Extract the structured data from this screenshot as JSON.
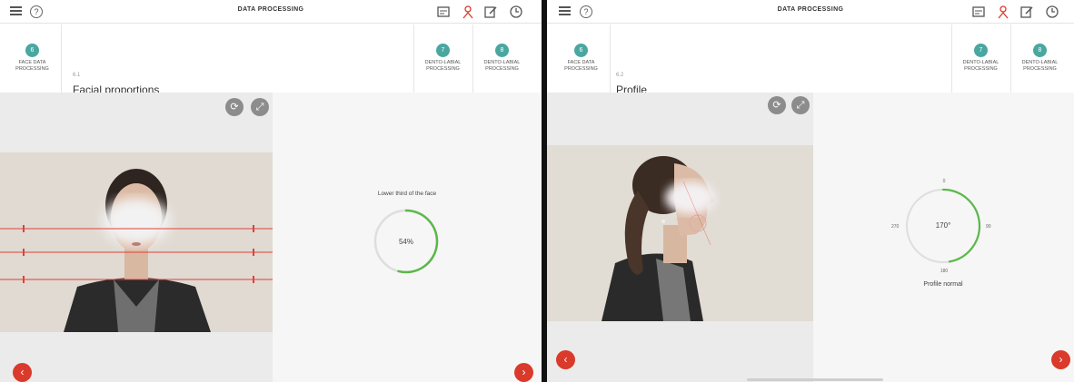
{
  "topbar": {
    "title": "DATA PROCESSING",
    "help_glyph": "?",
    "icons": [
      "menu-icon",
      "help-icon",
      "gallery-icon",
      "person-icon",
      "edit-icon",
      "history-icon"
    ],
    "accent_person_color": "#d93a2b"
  },
  "screens": [
    {
      "step_current": {
        "number": "6",
        "label": "FACE DATA PROCESSING"
      },
      "section_sub": "6.1",
      "section_title": "Facial proportions",
      "steps_next": [
        {
          "number": "7",
          "label": "DENTO-LABIAL PROCESSING"
        },
        {
          "number": "8",
          "label": "DENTO-LABIAL PROCESSING"
        }
      ],
      "result_title": "Lower third of the face",
      "gauge_value_text": "54%",
      "gauge_fraction": 0.54
    },
    {
      "step_current": {
        "number": "6",
        "label": "FACE DATA PROCESSING"
      },
      "section_sub": "6.2",
      "section_title": "Profile",
      "steps_next": [
        {
          "number": "7",
          "label": "DENTO-LABIAL PROCESSING"
        },
        {
          "number": "8",
          "label": "DENTO-LABIAL PROCESSING"
        }
      ],
      "gauge_value_text": "170°",
      "gauge_angle_deg": 170,
      "gauge_marks": {
        "top": "0",
        "right": "90",
        "bottom": "180",
        "left": "270"
      },
      "result_caption": "Profile normal"
    }
  ],
  "colors": {
    "teal_step": "#4aa7a0",
    "red_nav": "#d93a2b",
    "gauge_green": "#5bb84a",
    "guide_line_red": "#e2403a"
  }
}
